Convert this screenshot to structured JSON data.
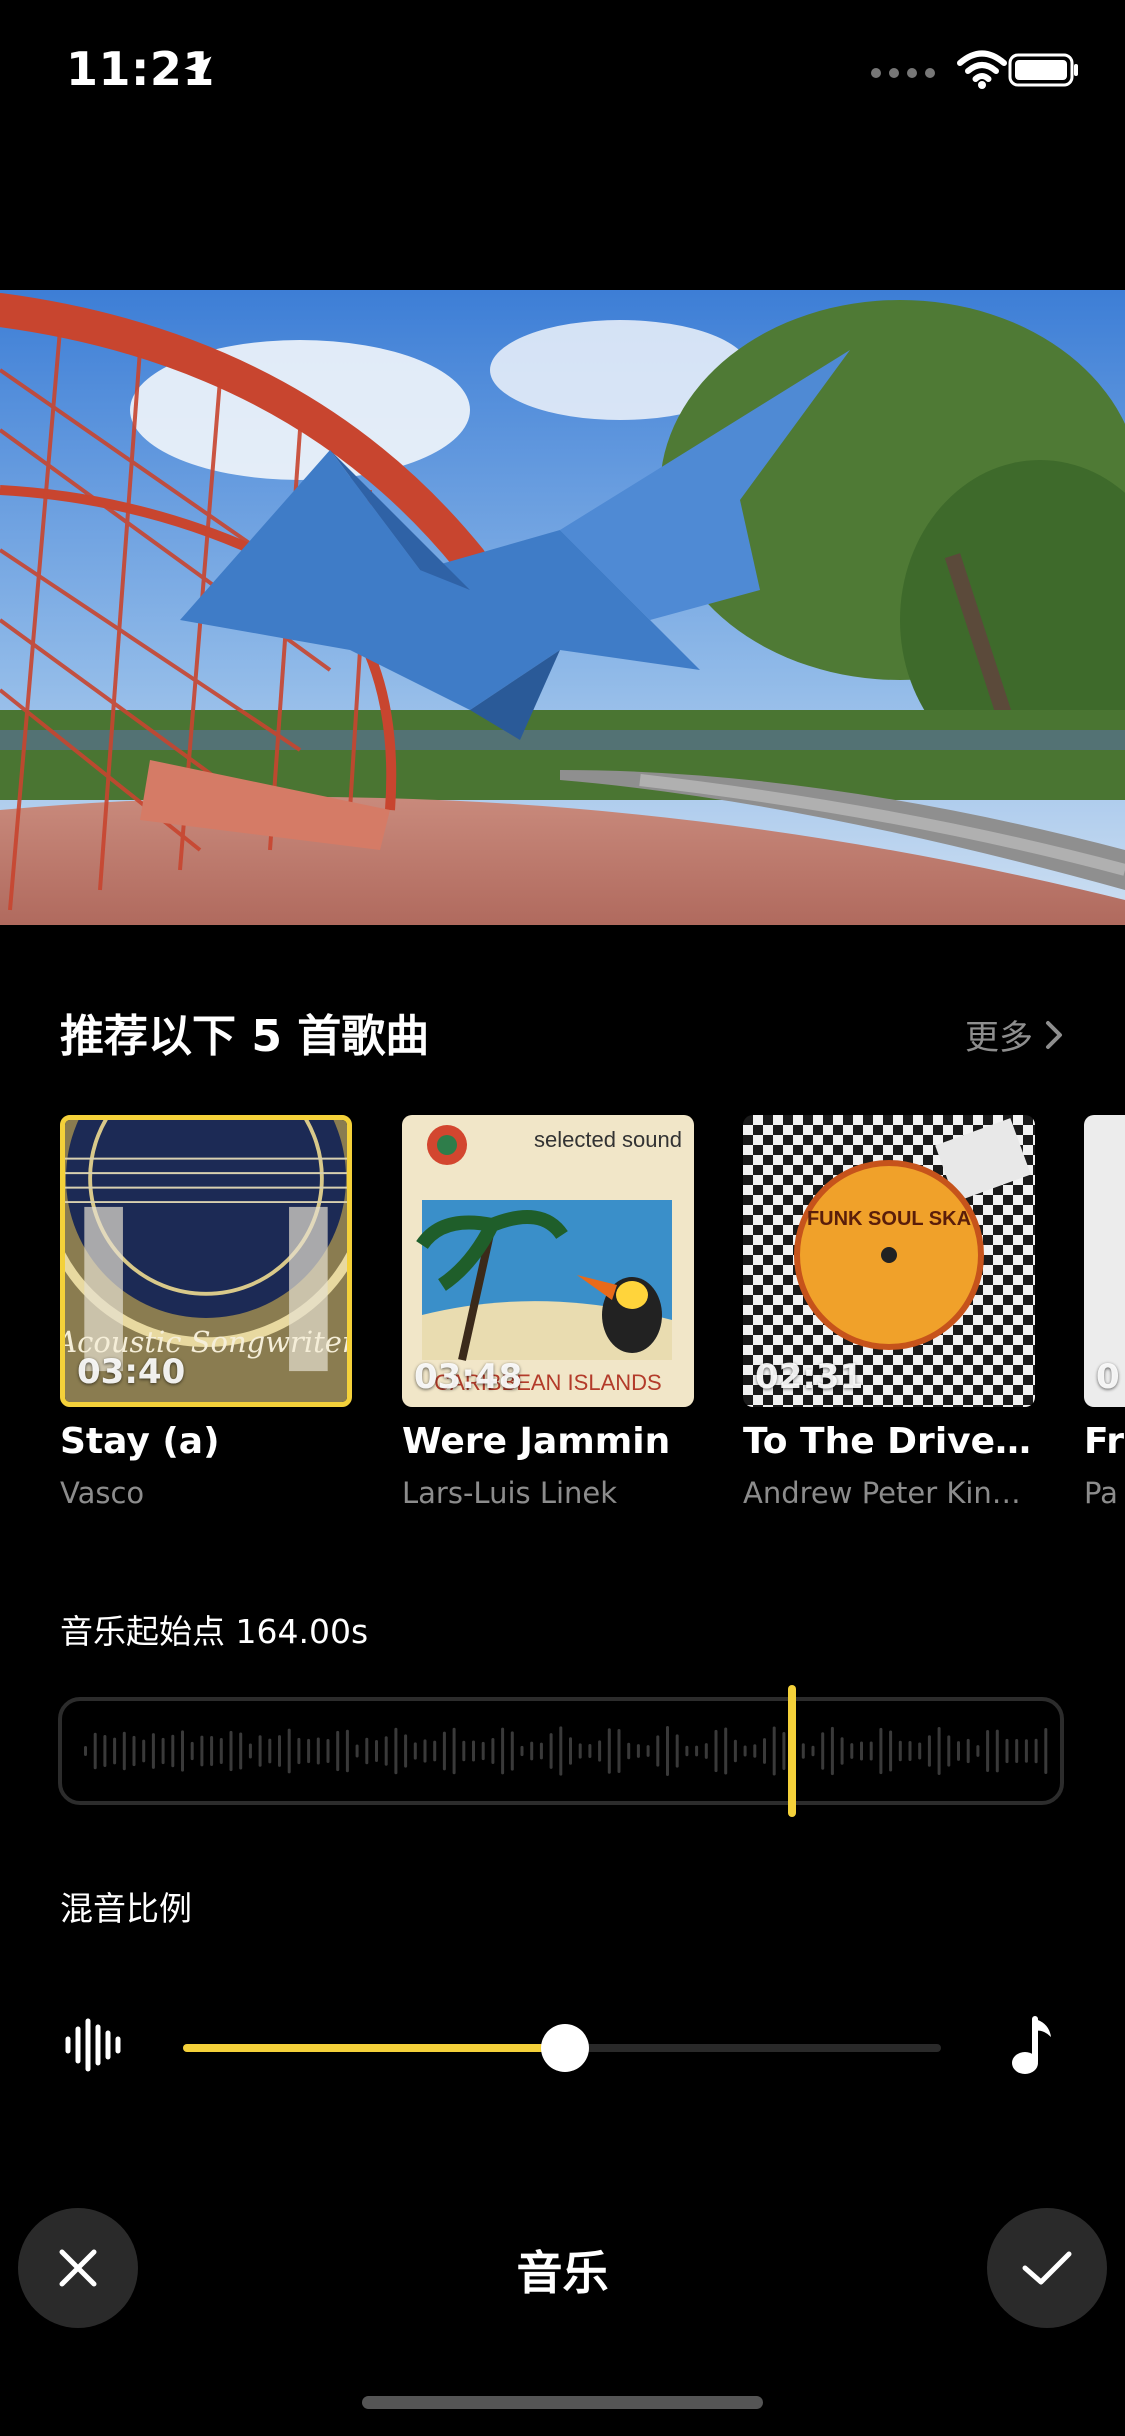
{
  "status_bar": {
    "time": "11:21",
    "icons": [
      "location-arrow-icon",
      "cellular-signal-icon",
      "wifi-icon",
      "battery-icon"
    ]
  },
  "recommend": {
    "title": "推荐以下 5 首歌曲",
    "more_label": "更多"
  },
  "songs": [
    {
      "title": "Stay (a)",
      "artist": "Vasco",
      "duration": "03:40",
      "selected": true
    },
    {
      "title": "Were Jammin",
      "artist": "Lars-Luis  Linek",
      "duration": "03:48",
      "selected": false
    },
    {
      "title": "To The Driveth...",
      "artist": "Andrew Peter King...",
      "duration": "02:31",
      "selected": false
    },
    {
      "title": "Fr",
      "artist": "Pa",
      "duration": "0",
      "selected": false
    }
  ],
  "cover_text": {
    "acoustic": "Acoustic Songwriter",
    "selected_sound": "selected sound",
    "caribbean": "CARIBBEAN ISLANDS",
    "funk": "FUNK SOUL SKA"
  },
  "start_point": {
    "label": "音乐起始点 164.00s"
  },
  "mix": {
    "label": "混音比例",
    "level": 0.5
  },
  "bottom_bar": {
    "title": "音乐"
  },
  "colors": {
    "accent": "#f4d13a",
    "background": "#000000",
    "muted_text": "#8c8c8c"
  }
}
